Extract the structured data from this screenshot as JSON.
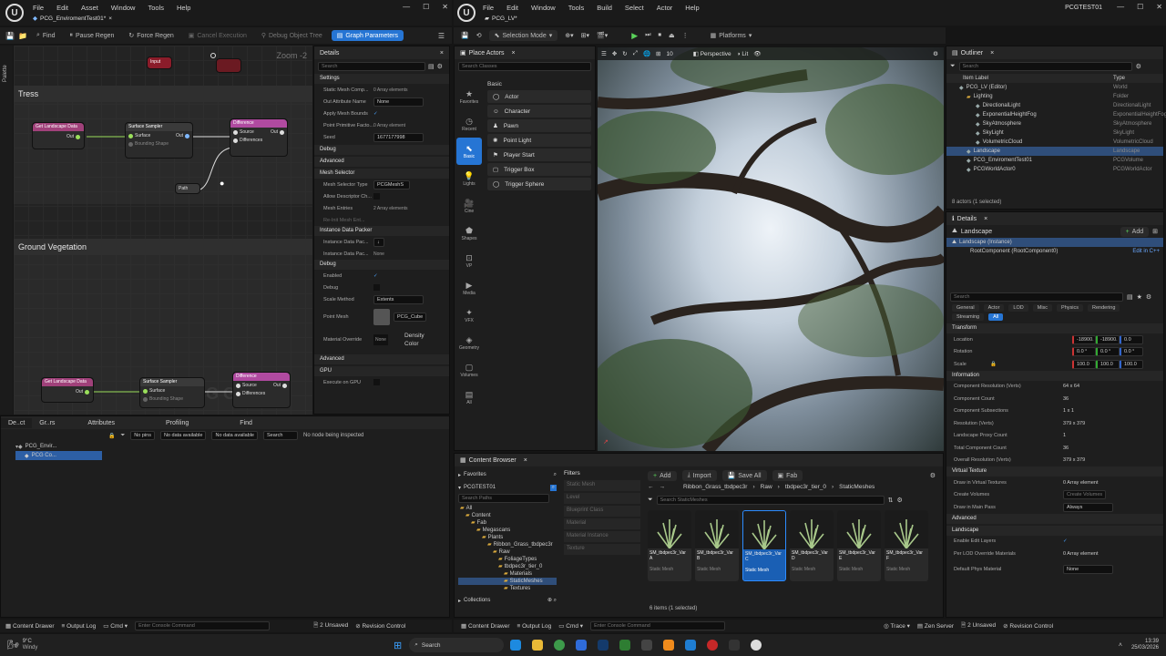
{
  "left_window": {
    "tab_title": "PCG_EnviromentTest01*",
    "menu": [
      "File",
      "Edit",
      "Asset",
      "Window",
      "Tools",
      "Help"
    ],
    "toolbar": {
      "find": "Find",
      "pause_regen": "Pause Regen",
      "force_regen": "Force Regen",
      "cancel_execution": "Cancel Execution",
      "debug_object_tree": "Debug Object Tree",
      "graph_parameters": "Graph Parameters"
    },
    "palette_label": "Palette",
    "zoom": "Zoom -2",
    "graph_watermark": "PCG Graph",
    "comment_tress": "Tress",
    "comment_ground": "Ground Vegetation",
    "nodes": {
      "input": "Input",
      "get_landscape": "Get Landscape Data",
      "surface_sampler": "Surface Sampler",
      "difference": "Difference",
      "out": "Out",
      "surface": "Surface",
      "bounding_shape": "Bounding Shape",
      "source": "Source",
      "differences": "Differences",
      "path": "Path"
    },
    "details": {
      "title": "Details",
      "search_placeholder": "Search",
      "sections": {
        "settings": "Settings",
        "debug": "Debug",
        "advanced": "Advanced",
        "mesh_selector": "Mesh Selector",
        "instance_packer": "Instance Data Packer",
        "debug2": "Debug",
        "advanced2": "Advanced",
        "gpu": "GPU"
      },
      "rows": {
        "static_mesh": "Static Mesh Comp...",
        "static_mesh_val": "0 Array elements",
        "out_attr": "Out Attribute Name",
        "out_attr_val": "None",
        "apply_bounds": "Apply Mesh Bounds",
        "point_primitive": "Point Primitive Facto...",
        "point_primitive_val": "0 Array element",
        "seed": "Seed",
        "seed_val": "1677177998",
        "mesh_selector_type": "Mesh Selector Type",
        "mesh_selector_val": "PCGMeshS",
        "allow_descriptor": "Allow Descriptor Ch...",
        "mesh_entries": "Mesh Entries",
        "mesh_entries_val": "2 Array elements",
        "re_init_mesh": "Re-Init Mesh Ent...",
        "instance_pack_1": "Instance Data Pac...",
        "instance_pack_2": "Instance Data Pac...",
        "instance_pack_2_val": "None",
        "enabled": "Enabled",
        "debug": "Debug",
        "scale_method": "Scale Method",
        "scale_method_val": "Extents",
        "point_mesh": "Point Mesh",
        "point_mesh_val": "PCG_Cube",
        "material_override": "Material Override",
        "material_override_val": "None",
        "density": "Density",
        "color": "Color",
        "execute_gpu": "Execute on GPU"
      }
    },
    "bottom_tabs": [
      "De..ct",
      "Gr..rs",
      "Attributes",
      "Profiling",
      "Find"
    ],
    "tree": {
      "root": "PCG_Envir...",
      "child": "PCG Co..."
    },
    "attr_bar": {
      "no_pins": "No pins",
      "no_data_1": "No data available",
      "no_data_2": "No data available",
      "search": "Search",
      "status": "No node being inspected"
    },
    "status": {
      "content_drawer": "Content Drawer",
      "output_log": "Output Log",
      "cmd": "Cmd",
      "console": "Enter Console Command",
      "unsaved": "2 Unsaved",
      "revision": "Revision Control"
    }
  },
  "right_window": {
    "tab_title": "PCG_LV*",
    "project": "PCGTEST01",
    "menu": [
      "File",
      "Edit",
      "Window",
      "Tools",
      "Build",
      "Select",
      "Actor",
      "Help"
    ],
    "selection_mode": "Selection Mode",
    "platforms": "Platforms",
    "place_actors": {
      "title": "Place Actors",
      "search_placeholder": "Search Classes",
      "category": "Basic",
      "side": [
        "Favorites",
        "Recent",
        "Basic",
        "Lights",
        "Cine",
        "Shapes",
        "VP",
        "Media",
        "VFX",
        "Geometry",
        "Volumes",
        "All"
      ],
      "items": [
        "Actor",
        "Character",
        "Pawn",
        "Point Light",
        "Player Start",
        "Trigger Box",
        "Trigger Sphere"
      ]
    },
    "viewport": {
      "perspective": "Perspective",
      "lit": "Lit",
      "speed": "10"
    },
    "outliner": {
      "title": "Outliner",
      "search_placeholder": "Search",
      "col_label": "Item Label",
      "col_type": "Type",
      "rows": [
        {
          "label": "PCG_LV (Editor)",
          "type": "World"
        },
        {
          "label": "Lighting",
          "type": "Folder"
        },
        {
          "label": "DirectionalLight",
          "type": "DirectionalLight"
        },
        {
          "label": "ExponentialHeightFog",
          "type": "ExponentialHeightFog"
        },
        {
          "label": "SkyAtmosphere",
          "type": "SkyAtmosphere"
        },
        {
          "label": "SkyLight",
          "type": "SkyLight"
        },
        {
          "label": "VolumetricCloud",
          "type": "VolumetricCloud"
        },
        {
          "label": "Landscape",
          "type": "Landscape"
        },
        {
          "label": "PCG_EnviromentTest01",
          "type": "PCGVolume"
        },
        {
          "label": "PCGWorldActor0",
          "type": "PCGWorldActor"
        }
      ],
      "footer": "8 actors (1 selected)"
    },
    "details": {
      "title": "Details",
      "object": "Landscape",
      "add": "Add",
      "instance": "Landscape (Instance)",
      "root_component": "RootComponent (RootComponent0)",
      "edit_cpp": "Edit in C++",
      "search_placeholder": "Search",
      "tabs": [
        "General",
        "Actor",
        "LOD",
        "Misc",
        "Physics",
        "Rendering",
        "Streaming",
        "All"
      ],
      "transform": "Transform",
      "location": "Location",
      "loc_vals": [
        "-18900.",
        "-18900.",
        "0.0"
      ],
      "rotation": "Rotation",
      "rot_vals": [
        "0.0 °",
        "0.0 °",
        "0.0 °"
      ],
      "scale": "Scale",
      "scale_vals": [
        "100.0",
        "100.0",
        "100.0"
      ],
      "information": "Information",
      "info": [
        {
          "l": "Component Resolution (Verts)",
          "v": "64 x 64"
        },
        {
          "l": "Component Count",
          "v": "36"
        },
        {
          "l": "Component Subsections",
          "v": "1 x 1"
        },
        {
          "l": "Resolution (Verts)",
          "v": "379 x 379"
        },
        {
          "l": "Landscape Proxy Count",
          "v": "1"
        },
        {
          "l": "Total Component Count",
          "v": "36"
        },
        {
          "l": "Overall Resolution (Verts)",
          "v": "379 x 379"
        }
      ],
      "virtual_texture": "Virtual Texture",
      "draw_vt": "Draw in Virtual Textures",
      "draw_vt_val": "0 Array element",
      "create_volumes": "Create Volumes",
      "create_volumes_btn": "Create Volumes",
      "draw_main": "Draw in Main Pass",
      "draw_main_val": "Always",
      "advanced": "Advanced",
      "landscape": "Landscape",
      "enable_edit": "Enable Edit Layers",
      "per_lod": "Per LOD Override Materials",
      "per_lod_val": "0 Array element",
      "default_phys": "Default Phys Material",
      "default_phys_val": "None"
    },
    "content_browser": {
      "title": "Content Browser",
      "add": "Add",
      "import": "Import",
      "save_all": "Save All",
      "fab": "Fab",
      "favorites": "Favorites",
      "project": "PCGTEST01",
      "search_paths": "Search Paths",
      "folders": [
        "All",
        "Content",
        "Fab",
        "Megascans",
        "Plants",
        "Ribbon_Grass_tbdpec3r",
        "Raw",
        "FoliageTypes",
        "tbdpec3r_tier_0",
        "Materials",
        "StaticMeshes",
        "Textures"
      ],
      "collections": "Collections",
      "filters": "Filters",
      "filter_items": [
        "Static Mesh",
        "Level",
        "Blueprint Class",
        "Material",
        "Material Instance",
        "Texture"
      ],
      "breadcrumb": [
        "Ribbon_Grass_tbdpec3r",
        "Raw",
        "tbdpec3r_tier_0",
        "StaticMeshes"
      ],
      "search_placeholder": "Search StaticMeshes",
      "assets": [
        {
          "name": "SM_tbdpec3r_Var A",
          "kind": "Static Mesh"
        },
        {
          "name": "SM_tbdpec3r_Var B",
          "kind": "Static Mesh"
        },
        {
          "name": "SM_tbdpec3r_Var C",
          "kind": "Static Mesh"
        },
        {
          "name": "SM_tbdpec3r_Var D",
          "kind": "Static Mesh"
        },
        {
          "name": "SM_tbdpec3r_Var E",
          "kind": "Static Mesh"
        },
        {
          "name": "SM_tbdpec3r_Var F",
          "kind": "Static Mesh"
        }
      ],
      "items_count": "6 items (1 selected)"
    },
    "status": {
      "content_drawer": "Content Drawer",
      "output_log": "Output Log",
      "cmd": "Cmd",
      "console": "Enter Console Command",
      "trace": "Trace",
      "zen": "Zen Server",
      "unsaved": "2 Unsaved",
      "revision": "Revision Control"
    }
  },
  "taskbar": {
    "weather_temp": "9°C",
    "weather_desc": "Windy",
    "search": "Search",
    "time": "13:39",
    "date": "25/03/2026"
  },
  "colors": {
    "accent": "#2675d4",
    "selected_asset": "#1a5fb4"
  }
}
